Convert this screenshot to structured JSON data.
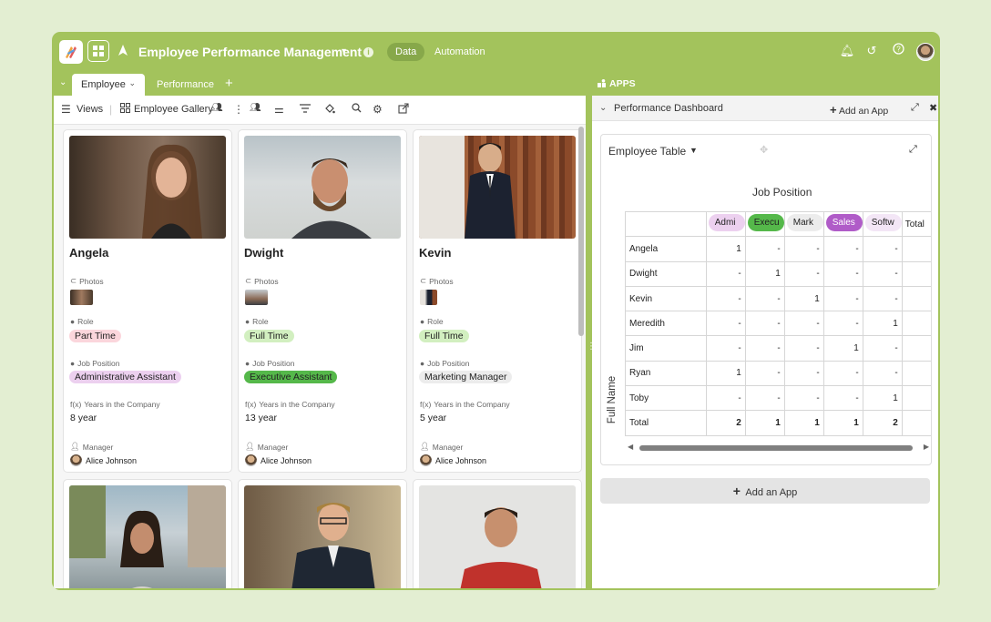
{
  "app": {
    "title": "Employee Performance Management",
    "data_tab": "Data",
    "automation_tab": "Automation",
    "accent_color": "#a3c35c"
  },
  "tabs": [
    {
      "label": "Employee",
      "active": true
    },
    {
      "label": "Performance",
      "active": false
    }
  ],
  "toolbar": {
    "views_label": "Views",
    "view_name": "Employee Gallery"
  },
  "field_labels": {
    "photos": "Photos",
    "role": "Role",
    "job_position": "Job Position",
    "years": "Years in the Company",
    "manager": "Manager"
  },
  "cards": [
    {
      "name": "Angela",
      "role": "Part Time",
      "job_position": "Administrative Assistant",
      "years": "8 year",
      "manager": "Alice Johnson"
    },
    {
      "name": "Dwight",
      "role": "Full Time",
      "job_position": "Executive Assistant",
      "years": "13 year",
      "manager": "Alice Johnson"
    },
    {
      "name": "Kevin",
      "role": "Full Time",
      "job_position": "Marketing Manager",
      "years": "5 year",
      "manager": "Alice Johnson"
    }
  ],
  "apps_panel": {
    "header": "APPS",
    "dashboard_title": "Performance Dashboard",
    "add_app_label": "Add an App",
    "widget_title": "Employee Table",
    "column_header": "Job Position",
    "row_header": "Full Name",
    "columns": [
      "Admi",
      "Execu",
      "Mark",
      "Sales",
      "Softw",
      "Total"
    ],
    "rows": [
      {
        "name": "Angela",
        "values": [
          "1",
          "-",
          "-",
          "-",
          "-"
        ]
      },
      {
        "name": "Dwight",
        "values": [
          "-",
          "1",
          "-",
          "-",
          "-"
        ]
      },
      {
        "name": "Kevin",
        "values": [
          "-",
          "-",
          "1",
          "-",
          "-"
        ]
      },
      {
        "name": "Meredith",
        "values": [
          "-",
          "-",
          "-",
          "-",
          "1"
        ]
      },
      {
        "name": "Jim",
        "values": [
          "-",
          "-",
          "-",
          "1",
          "-"
        ]
      },
      {
        "name": "Ryan",
        "values": [
          "1",
          "-",
          "-",
          "-",
          "-"
        ]
      },
      {
        "name": "Toby",
        "values": [
          "-",
          "-",
          "-",
          "-",
          "1"
        ]
      }
    ],
    "total_row": {
      "name": "Total",
      "values": [
        "2",
        "1",
        "1",
        "1",
        "2"
      ]
    },
    "add_app_button": "Add an App"
  }
}
